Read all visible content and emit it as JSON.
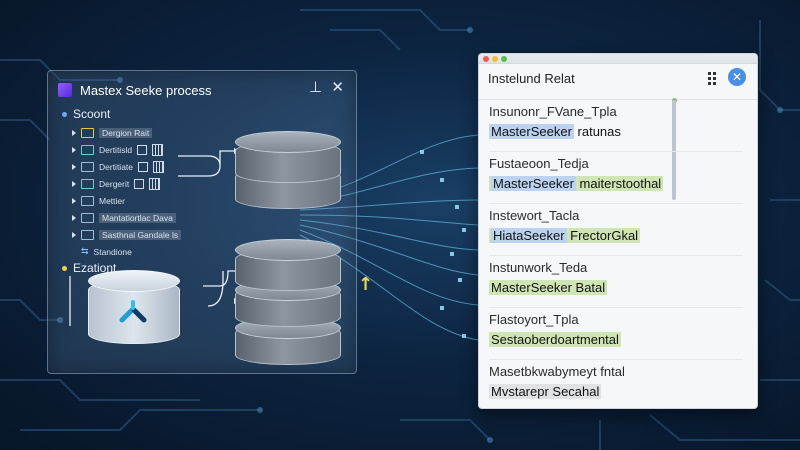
{
  "colors": {
    "accent": "#4a8ee6",
    "highlight_blue": "#bcd3f0",
    "highlight_green": "#cfe5b3",
    "arrow": "#f2d74d"
  },
  "left_panel": {
    "title": "Mastex Seeke process",
    "pin_glyph": "⊥",
    "close_glyph": "✕",
    "section1": "Scoont",
    "section2": "Ezationt",
    "tree": [
      {
        "label": "Dergion Rait",
        "icon": "yellow-folder-icon"
      },
      {
        "label": "Dertitisld",
        "icon": "table-icon"
      },
      {
        "label": "Dertitiate",
        "icon": "table-icon"
      },
      {
        "label": "Dergerit",
        "icon": "table-icon"
      },
      {
        "label": "Mettier",
        "icon": "table-icon"
      },
      {
        "label": "Mantatiortlac Dava",
        "icon": "database-icon"
      },
      {
        "label": "Sasthnal Gandale ls",
        "icon": "database-icon"
      },
      {
        "label": "Standione",
        "icon": "share-icon"
      }
    ]
  },
  "right_panel": {
    "title": "Instelund Relat",
    "close_glyph": "✕",
    "entries": [
      {
        "line1": "Insunonr_FVane_Tpla",
        "name": "MasterSeeker",
        "rest": " ratunas",
        "hl": "blue"
      },
      {
        "line1": "Fustaeoon_Tedja",
        "name": "MasterSeeker",
        "rest": " maiterstoothal",
        "hl": "green"
      },
      {
        "line1": "Instewort_Tacla",
        "name": "HiataSeeker",
        "rest": " FrectorGkal",
        "hl": "blue"
      },
      {
        "line1": "Instunwork_Teda",
        "name": "MasterSeeker",
        "rest": " Batal",
        "hl": "green"
      },
      {
        "line1": "Flastoyort_Tpla",
        "name": "Sestaoberdoar",
        "rest": "tmental",
        "hl": "green"
      },
      {
        "line1": "Masetbkwabymeyt fntal",
        "name": "Mvstarepr",
        "rest": " Secahal",
        "hl": "gray"
      }
    ]
  }
}
